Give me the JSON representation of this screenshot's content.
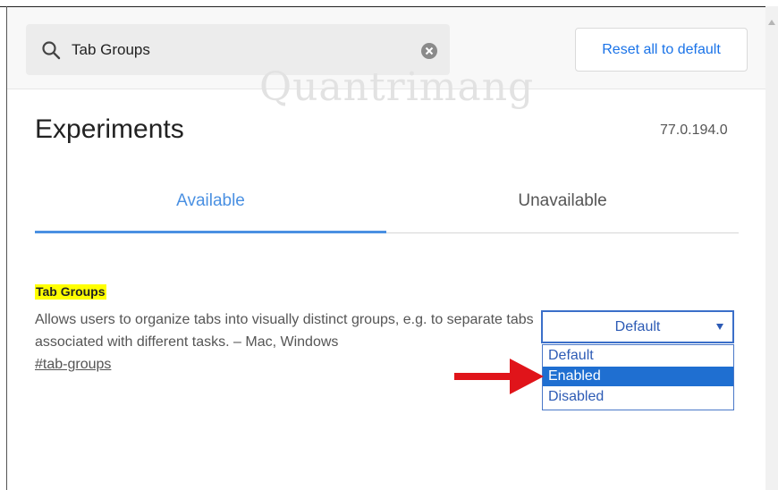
{
  "search": {
    "value": "Tab Groups"
  },
  "header": {
    "reset_label": "Reset all to default",
    "watermark": "Quantrimang"
  },
  "page": {
    "title": "Experiments",
    "version": "77.0.194.0"
  },
  "tabs": [
    {
      "label": "Available",
      "active": true
    },
    {
      "label": "Unavailable",
      "active": false
    }
  ],
  "experiment": {
    "name": "Tab Groups",
    "description": "Allows users to organize tabs into visually distinct groups, e.g. to separate tabs associated with different tasks. – Mac, Windows",
    "link": "#tab-groups",
    "select": {
      "value": "Default",
      "options": [
        "Default",
        "Enabled",
        "Disabled"
      ],
      "highlighted": "Enabled"
    }
  },
  "colors": {
    "accent": "#4a90e2",
    "highlight": "#ffff00",
    "selected_option": "#1f6fd1",
    "annotation_arrow": "#e0141a"
  },
  "icons": {
    "search": "search-icon",
    "clear": "clear-icon",
    "arrow": "red-arrow-icon"
  }
}
